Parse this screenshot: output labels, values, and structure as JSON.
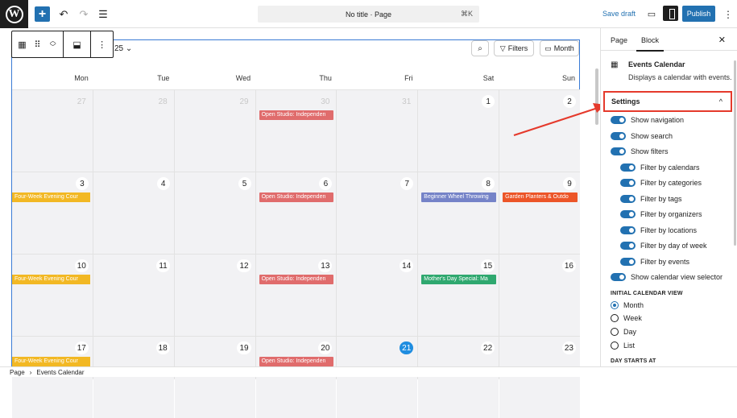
{
  "topbar": {
    "add_label": "+",
    "undo_icon": "↶",
    "redo_icon": "↷",
    "listview_icon": "☰",
    "doc_title": "No title · Page",
    "shortcut": "⌘K",
    "save_draft": "Save draft",
    "preview_icon": "▭",
    "publish": "Publish",
    "more_icon": "⋮"
  },
  "calendar": {
    "month_label": "25 ⌄",
    "filters_label": "Filters",
    "view_label": "Month",
    "weekdays": [
      "Mon",
      "Tue",
      "Wed",
      "Thu",
      "Fri",
      "Sat",
      "Sun"
    ],
    "days": [
      {
        "n": "27",
        "other": true
      },
      {
        "n": "28",
        "other": true
      },
      {
        "n": "29",
        "other": true
      },
      {
        "n": "30",
        "other": true
      },
      {
        "n": "31",
        "other": true
      },
      {
        "n": "1"
      },
      {
        "n": "2"
      },
      {
        "n": "3"
      },
      {
        "n": "4"
      },
      {
        "n": "5"
      },
      {
        "n": "6"
      },
      {
        "n": "7"
      },
      {
        "n": "8"
      },
      {
        "n": "9"
      },
      {
        "n": "10"
      },
      {
        "n": "11"
      },
      {
        "n": "12"
      },
      {
        "n": "13"
      },
      {
        "n": "14"
      },
      {
        "n": "15"
      },
      {
        "n": "16"
      },
      {
        "n": "17"
      },
      {
        "n": "18"
      },
      {
        "n": "19"
      },
      {
        "n": "20"
      },
      {
        "n": "21",
        "today": true
      },
      {
        "n": "22"
      },
      {
        "n": "23"
      }
    ],
    "events": [
      {
        "cell": 3,
        "label": "Open Studio: Independen",
        "color": "#e06c6c"
      },
      {
        "cell": 7,
        "label": "Four-Week Evening Cour",
        "color": "#f2b824",
        "full": true
      },
      {
        "cell": 10,
        "label": "Open Studio: Independen",
        "color": "#e06c6c"
      },
      {
        "cell": 12,
        "label": "Beginner Wheel Throwing",
        "color": "#7583c8"
      },
      {
        "cell": 13,
        "label": "Garden Planters & Outdo",
        "color": "#ec5528"
      },
      {
        "cell": 14,
        "label": "Four-Week Evening Cour",
        "color": "#f2b824",
        "full": true
      },
      {
        "cell": 17,
        "label": "Open Studio: Independen",
        "color": "#e06c6c"
      },
      {
        "cell": 19,
        "label": "Mother's Day Special: Ma",
        "color": "#2fa86f"
      },
      {
        "cell": 21,
        "label": "Four-Week Evening Cour",
        "color": "#f2b824",
        "full": true
      },
      {
        "cell": 24,
        "label": "Open Studio: Independen",
        "color": "#e06c6c"
      }
    ]
  },
  "sidebar": {
    "tab_page": "Page",
    "tab_block": "Block",
    "close_icon": "✕",
    "block_name": "Events Calendar",
    "block_desc": "Displays a calendar with events.",
    "settings_title": "Settings",
    "settings_chevron": "^",
    "toggles": [
      {
        "label": "Show navigation",
        "indent": false
      },
      {
        "label": "Show search",
        "indent": false
      },
      {
        "label": "Show filters",
        "indent": false
      },
      {
        "label": "Filter by calendars",
        "indent": true
      },
      {
        "label": "Filter by categories",
        "indent": true
      },
      {
        "label": "Filter by tags",
        "indent": true
      },
      {
        "label": "Filter by organizers",
        "indent": true
      },
      {
        "label": "Filter by locations",
        "indent": true
      },
      {
        "label": "Filter by day of week",
        "indent": true
      },
      {
        "label": "Filter by events",
        "indent": true
      },
      {
        "label": "Show calendar view selector",
        "indent": false
      }
    ],
    "initial_view_label": "INITIAL CALENDAR VIEW",
    "views": [
      {
        "label": "Month",
        "selected": true
      },
      {
        "label": "Week",
        "selected": false
      },
      {
        "label": "Day",
        "selected": false
      },
      {
        "label": "List",
        "selected": false
      }
    ],
    "day_starts_label": "DAY STARTS AT"
  },
  "footer": {
    "crumb_page": "Page",
    "sep": "›",
    "crumb_block": "Events Calendar"
  }
}
